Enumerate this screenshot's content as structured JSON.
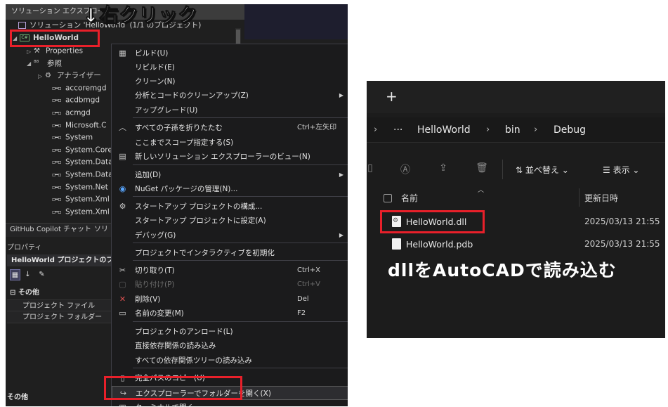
{
  "vs": {
    "solution_explorer_title": "ソリューション エクスプローラー",
    "solution_line": "ソリューション 'HelloWorld' (1/1 のプロジェクト)",
    "project": "HelloWorld",
    "project_badge": "C#",
    "tree": [
      {
        "label": "Properties",
        "icon": "wrench-icon"
      },
      {
        "label": "参照",
        "icon": "references-icon"
      },
      {
        "label": "アナライザー",
        "icon": "analyzer-icon"
      },
      {
        "label": "accoremgd",
        "icon": "reference-icon"
      },
      {
        "label": "acdbmgd",
        "icon": "reference-icon"
      },
      {
        "label": "acmgd",
        "icon": "reference-icon"
      },
      {
        "label": "Microsoft.C",
        "icon": "reference-icon"
      },
      {
        "label": "System",
        "icon": "reference-icon"
      },
      {
        "label": "System.Core",
        "icon": "reference-icon"
      },
      {
        "label": "System.Data",
        "icon": "reference-icon"
      },
      {
        "label": "System.Data",
        "icon": "reference-icon"
      },
      {
        "label": "System.Net",
        "icon": "reference-icon"
      },
      {
        "label": "System.Xml",
        "icon": "reference-icon"
      },
      {
        "label": "System.Xml",
        "icon": "reference-icon"
      }
    ],
    "tabs": [
      "GitHub Copilot チャット",
      "ソリ"
    ],
    "properties": {
      "title": "プロパティ",
      "object": "HelloWorld プロジェクトのプロパティ",
      "category": "その他",
      "rows": [
        "プロジェクト ファイル",
        "プロジェクト フォルダー"
      ],
      "description_title": "その他"
    },
    "callout": "↓右クリック"
  },
  "menu": [
    {
      "label": "ビルド(U)",
      "icon": "build-icon",
      "shortcut": "",
      "submenu": false,
      "disabled": false
    },
    {
      "label": "リビルド(E)",
      "icon": "",
      "shortcut": "",
      "submenu": false,
      "disabled": false
    },
    {
      "label": "クリーン(N)",
      "icon": "",
      "shortcut": "",
      "submenu": false,
      "disabled": false
    },
    {
      "label": "分析とコードのクリーンアップ(Z)",
      "icon": "",
      "shortcut": "",
      "submenu": true,
      "disabled": false
    },
    {
      "label": "アップグレード(U)",
      "icon": "",
      "shortcut": "",
      "submenu": false,
      "disabled": false
    },
    {
      "label": "すべての子孫を折りたたむ",
      "icon": "collapse-icon",
      "shortcut": "Ctrl+左矢印",
      "submenu": false,
      "disabled": false
    },
    {
      "label": "ここまでスコープ指定する(S)",
      "icon": "",
      "shortcut": "",
      "submenu": false,
      "disabled": false
    },
    {
      "label": "新しいソリューション エクスプローラーのビュー(N)",
      "icon": "new-view-icon",
      "shortcut": "",
      "submenu": false,
      "disabled": false
    },
    {
      "label": "追加(D)",
      "icon": "",
      "shortcut": "",
      "submenu": true,
      "disabled": false
    },
    {
      "label": "NuGet パッケージの管理(N)...",
      "icon": "nuget-icon",
      "shortcut": "",
      "submenu": false,
      "disabled": false
    },
    {
      "label": "スタートアップ プロジェクトの構成...",
      "icon": "gear-icon",
      "shortcut": "",
      "submenu": false,
      "disabled": false
    },
    {
      "label": "スタートアップ プロジェクトに設定(A)",
      "icon": "",
      "shortcut": "",
      "submenu": false,
      "disabled": false
    },
    {
      "label": "デバッグ(G)",
      "icon": "",
      "shortcut": "",
      "submenu": true,
      "disabled": false
    },
    {
      "label": "プロジェクトでインタラクティブを初期化",
      "icon": "",
      "shortcut": "",
      "submenu": false,
      "disabled": false
    },
    {
      "label": "切り取り(T)",
      "icon": "scissors-icon",
      "shortcut": "Ctrl+X",
      "submenu": false,
      "disabled": false
    },
    {
      "label": "貼り付け(P)",
      "icon": "paste-icon",
      "shortcut": "Ctrl+V",
      "submenu": false,
      "disabled": true
    },
    {
      "label": "削除(V)",
      "icon": "delete-icon",
      "shortcut": "Del",
      "submenu": false,
      "disabled": false
    },
    {
      "label": "名前の変更(M)",
      "icon": "rename-icon",
      "shortcut": "F2",
      "submenu": false,
      "disabled": false
    },
    {
      "label": "プロジェクトのアンロード(L)",
      "icon": "",
      "shortcut": "",
      "submenu": false,
      "disabled": false
    },
    {
      "label": "直接依存関係の読み込み",
      "icon": "",
      "shortcut": "",
      "submenu": false,
      "disabled": false
    },
    {
      "label": "すべての依存関係ツリーの読み込み",
      "icon": "",
      "shortcut": "",
      "submenu": false,
      "disabled": false
    },
    {
      "label": "完全パスのコピー(U)",
      "icon": "copy-path-icon",
      "shortcut": "",
      "submenu": false,
      "disabled": false
    },
    {
      "label": "エクスプローラーでフォルダーを開く(X)",
      "icon": "open-folder-icon",
      "shortcut": "",
      "submenu": false,
      "disabled": false
    },
    {
      "label": "ターミナルで開く",
      "icon": "terminal-icon",
      "shortcut": "",
      "submenu": false,
      "disabled": false
    }
  ],
  "explorer": {
    "new_tab": "+",
    "breadcrumb": [
      "···",
      "HelloWorld",
      "bin",
      "Debug"
    ],
    "sort_label": "並べ替え",
    "view_label": "表示",
    "col_name": "名前",
    "col_date": "更新日時",
    "files": [
      {
        "name": "HelloWorld.dll",
        "date": "2025/03/13 21:55",
        "icon": "dll-file-icon"
      },
      {
        "name": "HelloWorld.pdb",
        "date": "2025/03/13 21:55",
        "icon": "file-icon"
      }
    ],
    "callout": "dllをAutoCADで読み込む"
  },
  "colors": {
    "callout_red": "#e8202a",
    "vs_bg": "#1f1f1f",
    "explorer_bg": "#1c1c1c"
  }
}
